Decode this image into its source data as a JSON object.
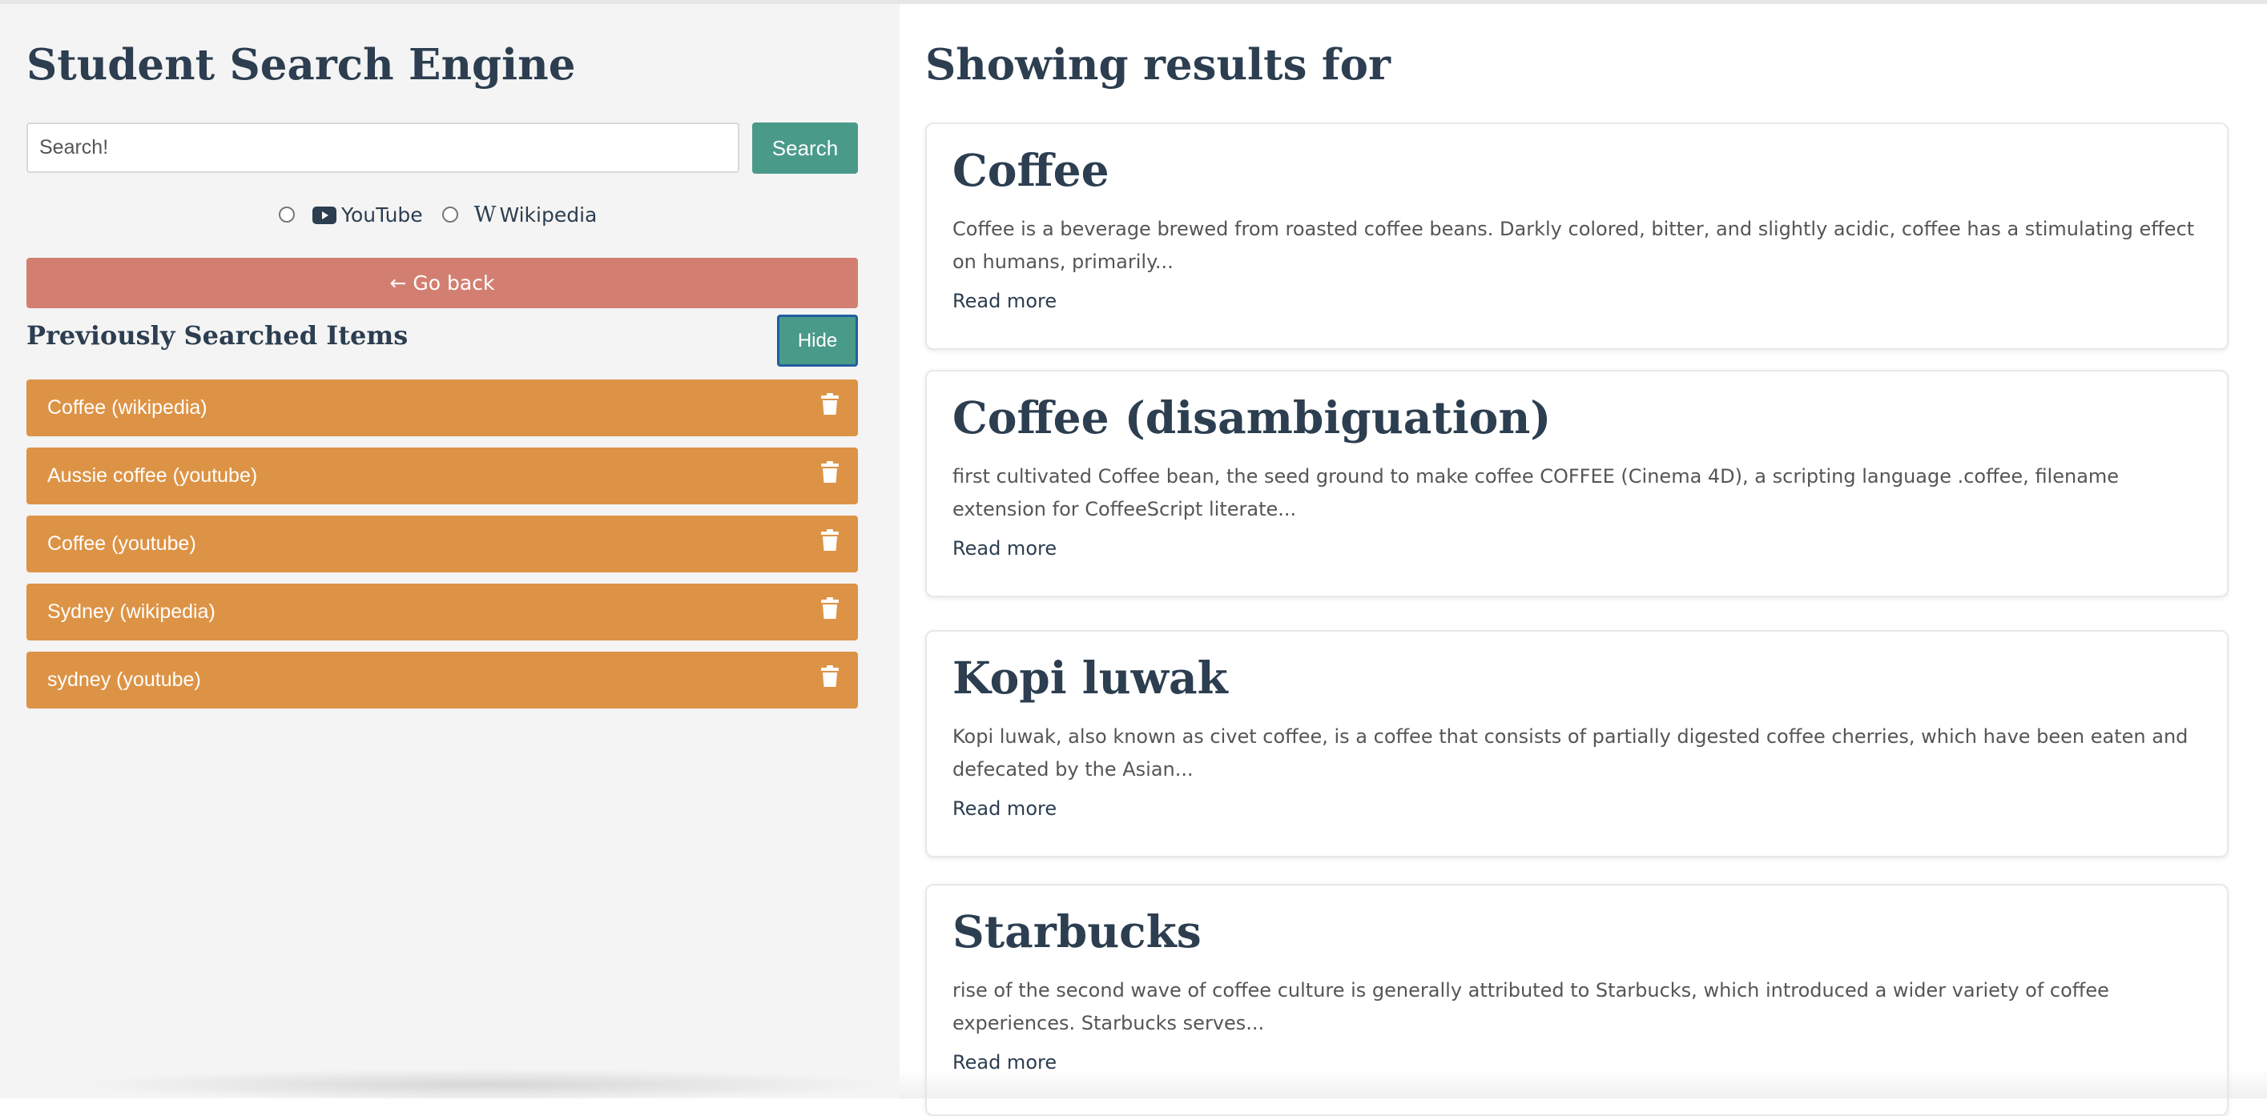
{
  "app": {
    "title": "Student Search Engine"
  },
  "search": {
    "placeholder": "Search!",
    "value": "",
    "button_label": "Search"
  },
  "sources": [
    {
      "label": "YouTube",
      "icon": "youtube-icon",
      "selected": false
    },
    {
      "label": "Wikipedia",
      "icon": "wikipedia-icon",
      "selected": false
    }
  ],
  "go_back_label": "← Go back",
  "history": {
    "title": "Previously Searched Items",
    "hide_label": "Hide",
    "items": [
      {
        "label": "Coffee (wikipedia)"
      },
      {
        "label": "Aussie coffee (youtube)"
      },
      {
        "label": "Coffee (youtube)"
      },
      {
        "label": "Sydney (wikipedia)"
      },
      {
        "label": "sydney (youtube)"
      }
    ]
  },
  "results": {
    "title": "Showing results for",
    "items": [
      {
        "title": "Coffee",
        "snippet": "Coffee is a beverage brewed from roasted coffee beans. Darkly colored, bitter, and slightly acidic, coffee has a stimulating effect on humans, primarily...",
        "read_more": "Read more"
      },
      {
        "title": "Coffee (disambiguation)",
        "snippet": "first cultivated Coffee bean, the seed ground to make coffee COFFEE (Cinema 4D), a scripting language .coffee, filename extension for CoffeeScript literate...",
        "read_more": "Read more"
      },
      {
        "title": "Kopi luwak",
        "snippet": "Kopi luwak, also known as civet coffee, is a coffee that consists of partially digested coffee cherries, which have been eaten and defecated by the Asian...",
        "read_more": "Read more"
      },
      {
        "title": "Starbucks",
        "snippet": "rise of the second wave of coffee culture is generally attributed to Starbucks, which introduced a wider variety of coffee experiences. Starbucks serves...",
        "read_more": "Read more"
      }
    ]
  },
  "colors": {
    "accent_teal": "#4a9a8a",
    "history_orange": "#dd9345",
    "go_back_red": "#d27f72",
    "heading_navy": "#2c3e50"
  }
}
